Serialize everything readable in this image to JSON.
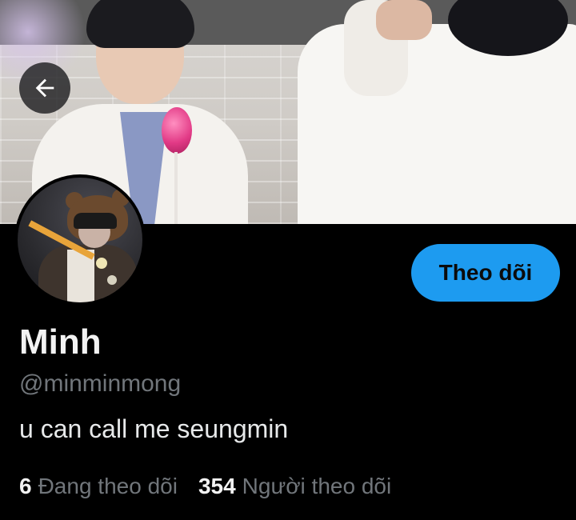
{
  "profile": {
    "display_name": "Minh",
    "handle": "@minminmong",
    "bio": "u can call me seungmin",
    "follow_button_label": "Theo dõi",
    "stats": {
      "following_count": "6",
      "following_label": "Đang theo dõi",
      "followers_count": "354",
      "followers_label": "Người theo dõi"
    }
  },
  "icons": {
    "back": "arrow-left-icon"
  },
  "colors": {
    "background": "#000000",
    "accent": "#1d9bf0",
    "primary_text": "#e7e9ea",
    "secondary_text": "#71767b"
  }
}
